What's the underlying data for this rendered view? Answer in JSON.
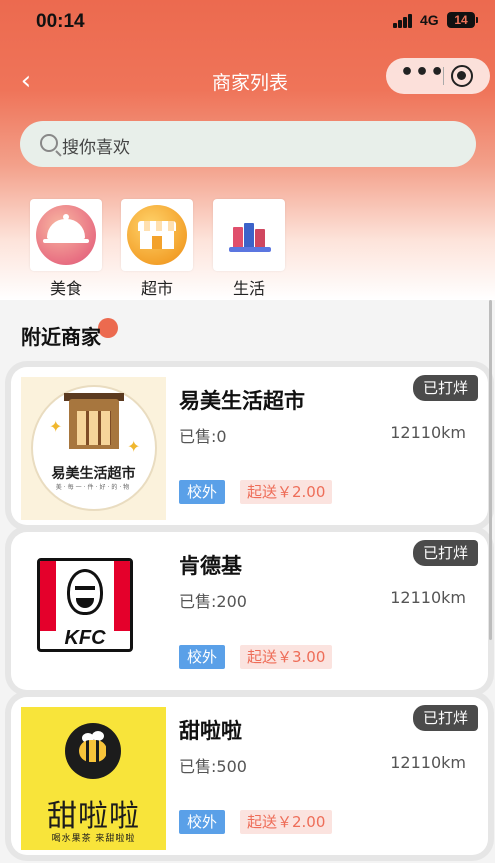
{
  "status_bar": {
    "time": "00:14",
    "network": "4G",
    "battery": "14"
  },
  "nav": {
    "back_icon": "‹",
    "title": "商家列表",
    "more_icon": "•••"
  },
  "search": {
    "placeholder": "搜你喜欢"
  },
  "categories": [
    {
      "label": "美食",
      "icon": "food-cloche-icon"
    },
    {
      "label": "超市",
      "icon": "supermarket-icon"
    },
    {
      "label": "生活",
      "icon": "books-icon"
    }
  ],
  "section": {
    "title": "附近商家"
  },
  "merchants": [
    {
      "name": "易美生活超市",
      "sold": "已售:0",
      "distance": "12110km",
      "badge": "已打烊",
      "tag_campus": "校外",
      "tag_delivery": "起送￥2.00",
      "logo_text": "易美生活超市",
      "logo_sub": "美·每一·件·好·的·物"
    },
    {
      "name": "肯德基",
      "sold": "已售:200",
      "distance": "12110km",
      "badge": "已打烊",
      "tag_campus": "校外",
      "tag_delivery": "起送￥3.00",
      "logo_text": "KFC"
    },
    {
      "name": "甜啦啦",
      "sold": "已售:500",
      "distance": "12110km",
      "badge": "已打烊",
      "tag_campus": "校外",
      "tag_delivery": "起送￥2.00",
      "logo_text": "甜啦啦",
      "logo_sub": "喝水果茶  来甜啦啦"
    }
  ],
  "colors": {
    "brand": "#ec6a4f",
    "campus_tag": "#5aa0e8",
    "delivery_tag_text": "#ee6d58",
    "closed_badge": "#4b4b4b"
  }
}
